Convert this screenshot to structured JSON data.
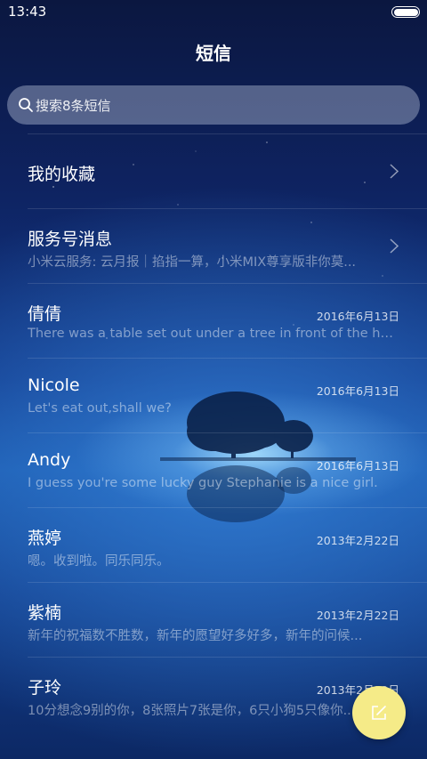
{
  "status_bar": {
    "time": "13:43",
    "battery_level": 1.0
  },
  "header": {
    "title": "短信"
  },
  "search": {
    "placeholder": "搜索8条短信"
  },
  "rows": [
    {
      "title": "我的收藏",
      "date": "",
      "preview": "",
      "has_chevron": true
    },
    {
      "title": "服务号消息",
      "date": "",
      "preview": "小米云服务: 云月报｜掐指一算，小米MIX尊享版非你莫...",
      "has_chevron": true
    },
    {
      "title": "倩倩",
      "date": "2016年6月13日",
      "preview": "There was a table set out under a tree in front of the ho...",
      "has_chevron": false
    },
    {
      "title": "Nicole",
      "date": "2016年6月13日",
      "preview": "Let's eat out,shall we?",
      "has_chevron": false
    },
    {
      "title": "Andy",
      "date": "2016年6月13日",
      "preview": "I guess you're some lucky guy Stephanie is a nice girl.",
      "has_chevron": false
    },
    {
      "title": "燕婷",
      "date": "2013年2月22日",
      "preview": "嗯。收到啦。同乐同乐。",
      "has_chevron": false
    },
    {
      "title": "紫楠",
      "date": "2013年2月22日",
      "preview": "新年的祝福数不胜数，新年的愿望好多好多，新年的问候...",
      "has_chevron": false
    },
    {
      "title": "子玲",
      "date": "2013年2月22日",
      "preview": "10分想念9别的你，8张照片7张是你，6只小狗5只像你...",
      "has_chevron": false
    }
  ],
  "fab": {
    "icon": "compose-icon"
  },
  "colors": {
    "fab": "#f5eb88",
    "background_top": "#0b1740",
    "background_mid": "#1a58ad"
  }
}
